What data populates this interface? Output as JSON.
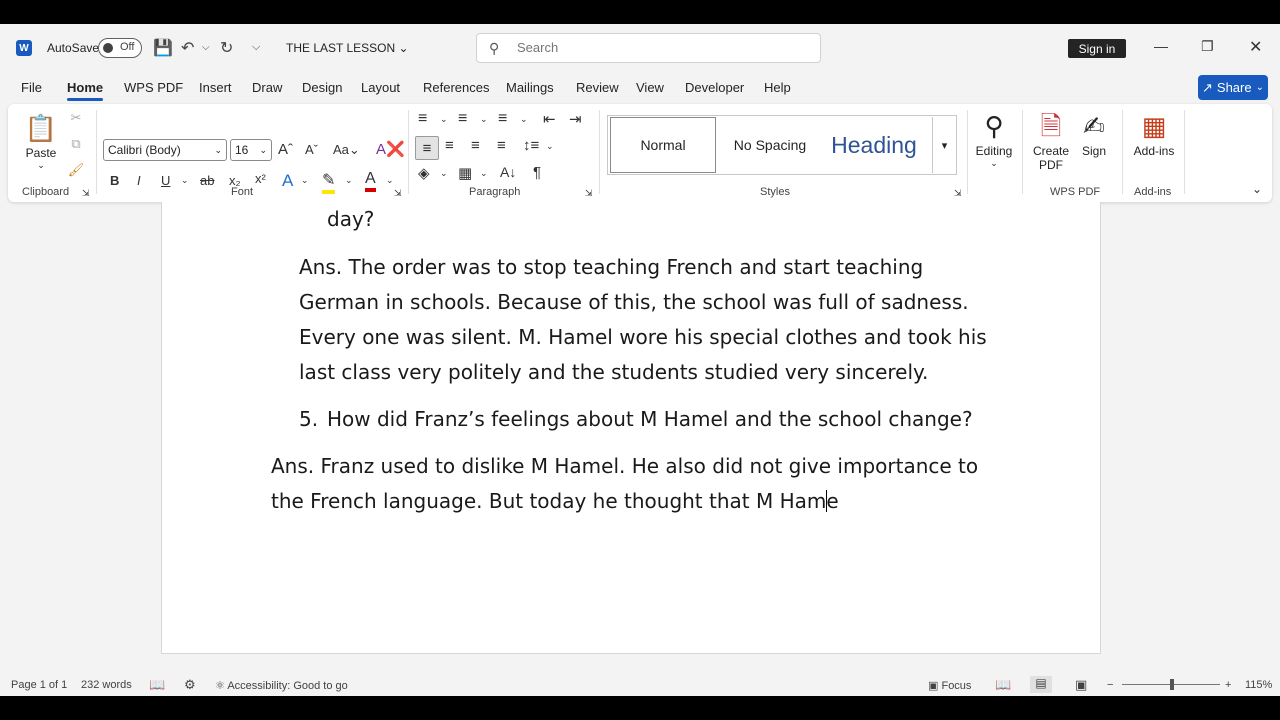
{
  "titlebar": {
    "app_letter": "W",
    "autosave_label": "AutoSave",
    "autosave_state": "Off",
    "doc_title": "THE LAST LESSON",
    "search_placeholder": "Search",
    "signin": "Sign in"
  },
  "tabs": [
    "File",
    "Home",
    "WPS PDF",
    "Insert",
    "Draw",
    "Design",
    "Layout",
    "References",
    "Mailings",
    "Review",
    "View",
    "Developer",
    "Help"
  ],
  "share": "Share",
  "ribbon": {
    "clipboard": {
      "paste": "Paste",
      "label": "Clipboard"
    },
    "font": {
      "name": "Calibri (Body)",
      "size": "16",
      "label": "Font"
    },
    "paragraph": {
      "label": "Paragraph"
    },
    "styles": {
      "normal": "Normal",
      "nospacing": "No Spacing",
      "heading": "Heading",
      "label": "Styles"
    },
    "editing": "Editing",
    "wps": {
      "create_pdf": "Create PDF",
      "sign": "Sign",
      "label": "WPS PDF"
    },
    "addins": {
      "btn": "Add-ins",
      "label": "Add-ins"
    }
  },
  "document": {
    "line0": "day?",
    "ans1": [
      "Ans. The order was to stop teaching French and start teaching",
      "German in schools. Because of this, the school was full of sadness.",
      "Every one was silent. M. Hamel wore his special clothes and took his",
      "last class very politely and the students studied very sincerely."
    ],
    "q5_num": "5.",
    "q5": "How did Franz’s feelings about M Hamel and the school change?",
    "ans2_line1": "Ans. Franz used to dislike M Hamel. He also did not give importance to",
    "ans2_line2_before": "the French language. But today he thought that M Ham",
    "ans2_line2_after": "e"
  },
  "status": {
    "page": "Page 1 of 1",
    "words": "232 words",
    "accessibility": "Accessibility: Good to go",
    "focus": "Focus",
    "zoom": "115%"
  }
}
